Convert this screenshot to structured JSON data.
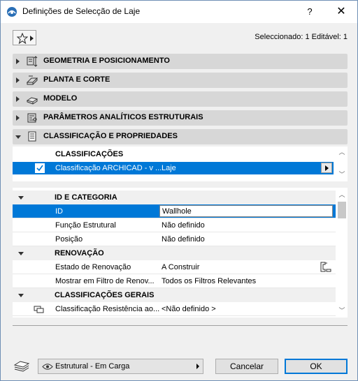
{
  "window": {
    "title": "Definições de Selecção de Laje",
    "help_label": "?",
    "close_label": "✕"
  },
  "toolbar": {
    "selected_info": "Seleccionado: 1 Editável: 1"
  },
  "sections": [
    {
      "label": "GEOMETRIA E POSICIONAMENTO",
      "icon": "geometry-icon",
      "expanded": false
    },
    {
      "label": "PLANTA E CORTE",
      "icon": "floor-plan-icon",
      "expanded": false
    },
    {
      "label": "MODELO",
      "icon": "model-icon",
      "expanded": false
    },
    {
      "label": "PARÂMETROS ANALÍTICOS ESTRUTURAIS",
      "icon": "structural-analytical-icon",
      "expanded": false
    },
    {
      "label": "CLASSIFICAÇÃO E PROPRIEDADES",
      "icon": "classification-icon",
      "expanded": true
    }
  ],
  "classifications": {
    "header": "CLASSIFICAÇÕES",
    "row": {
      "checked": true,
      "name": "Classificação ARCHICAD - v ...",
      "value": "Laje"
    }
  },
  "properties": {
    "id_group": "ID E CATEGORIA",
    "id": {
      "name": "ID",
      "value": "Wallhole"
    },
    "structural_function": {
      "name": "Função Estrutural",
      "value": "Não definido"
    },
    "position": {
      "name": "Posição",
      "value": "Não definido"
    },
    "renovation_group": "RENOVAÇÃO",
    "renovation_status": {
      "name": "Estado de Renovação",
      "value": "A Construir"
    },
    "renovation_filter": {
      "name": "Mostrar em Filtro de Renov...",
      "value": "Todos os Filtros Relevantes"
    },
    "general_group": "CLASSIFICAÇÕES GERAIS",
    "fire_resistance": {
      "name": "Classificação Resistência ao...",
      "value": "<Não definido >"
    }
  },
  "footer": {
    "view_option": "Estrutural - Em Carga",
    "cancel_label": "Cancelar",
    "ok_label": "OK"
  },
  "colors": {
    "accent": "#0078d7",
    "section_bg": "#d7d7d7"
  }
}
